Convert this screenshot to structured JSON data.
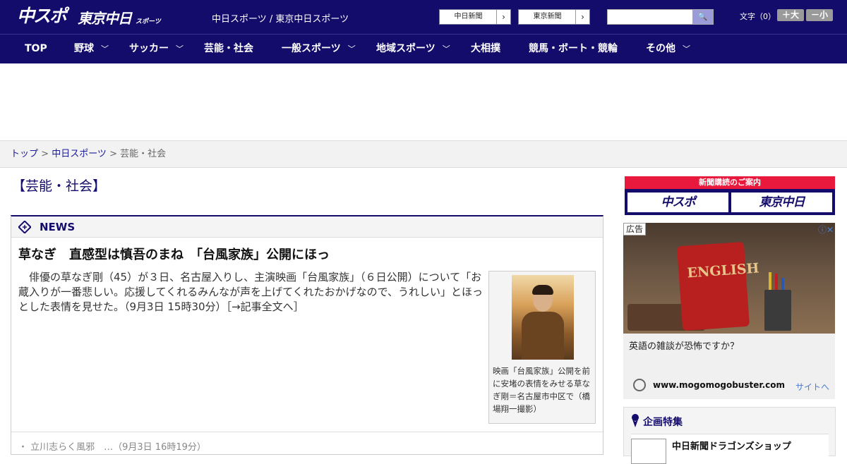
{
  "header": {
    "logo_text": "中スポ",
    "logo2_text": "東京中日",
    "logo2_sub": "スポーツ",
    "site_links": "中日スポーツ / 東京中日スポーツ",
    "btn_chunichi": "中日新聞",
    "btn_tokyo": "東京新聞",
    "fontsize_label": "文字（0）",
    "font_plus": "＋大",
    "font_minus": "－小"
  },
  "nav": [
    {
      "label": "TOP"
    },
    {
      "label": "野球",
      "chevron": "﹀"
    },
    {
      "label": "サッカー",
      "chevron": "﹀"
    },
    {
      "label": "芸能・社会"
    },
    {
      "label": "一般スポーツ",
      "chevron": "﹀"
    },
    {
      "label": "地域スポーツ",
      "chevron": "﹀"
    },
    {
      "label": "大相撲"
    },
    {
      "label": "競馬・ボート・競輪"
    },
    {
      "label": "その他",
      "chevron": "﹀"
    }
  ],
  "breadcrumb": {
    "top": "トップ",
    "sep": " > ",
    "chunichi": "中日スポーツ",
    "current": "芸能・社会"
  },
  "section_title": "【芸能・社会】",
  "news": {
    "label": "NEWS",
    "headline": "草なぎ　直感型は慎吾のまね　「台風家族」公開にほっ",
    "body": "俳優の草なぎ剛（45）が３日、名古屋入りし、主演映画「台風家族」（６日公開）について「お蔵入りが一番悲しい。応援してくれるみんなが声を上げてくれたおかげなので、うれしい」とほっとした表情を見せた。（9月3日 15時30分）［→記事全文へ］",
    "caption": "映画「台風家族」公開を前に安堵の表情をみせる草なぎ剛＝名古屋市中区で（橋場翔一撮影）",
    "next_item": "・ 立川志らく風邪　…（9月3日 16時19分）"
  },
  "sidebar": {
    "banner_title": "新聞購読のご案内",
    "banner_logo1": "中スポ",
    "banner_logo2": "東京中日",
    "ad_label": "広告",
    "ad_close": "ⓘ✕",
    "ad_book_text": "ENGLISH",
    "ad_headline": "英語の雑談が恐怖ですか？",
    "ad_url": "www.mogomogobuster.com",
    "ad_cta": "サイトへ",
    "feature_title": "企画特集",
    "feature_item": "中日新聞ドラゴンズショップ"
  },
  "colors": {
    "brand": "#140c6b",
    "accent_red": "#e8193c"
  }
}
